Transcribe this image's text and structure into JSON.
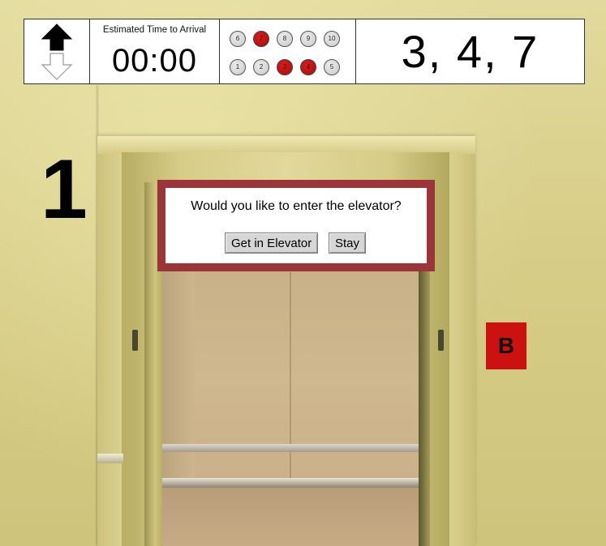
{
  "status_bar": {
    "direction": {
      "up_active": true,
      "down_active": false
    },
    "eta": {
      "label": "Estimated Time to Arrival",
      "time": "00:00"
    },
    "floor_panel": {
      "rows": [
        [
          {
            "label": "6",
            "lit": false
          },
          {
            "label": "7",
            "lit": true
          },
          {
            "label": "8",
            "lit": false
          },
          {
            "label": "9",
            "lit": false
          },
          {
            "label": "10",
            "lit": false
          }
        ],
        [
          {
            "label": "1",
            "lit": false
          },
          {
            "label": "2",
            "lit": false
          },
          {
            "label": "3",
            "lit": true
          },
          {
            "label": "4",
            "lit": true
          },
          {
            "label": "5",
            "lit": false
          }
        ]
      ],
      "lit_color": "#cc1111"
    },
    "queued_floors": "3, 4, 7"
  },
  "current_floor": "1",
  "badge": {
    "label": "B",
    "color": "#cc1111"
  },
  "dialog": {
    "question": "Would you like to enter the elevator?",
    "enter_label": "Get in Elevator",
    "stay_label": "Stay",
    "border_color": "#9b3539"
  }
}
